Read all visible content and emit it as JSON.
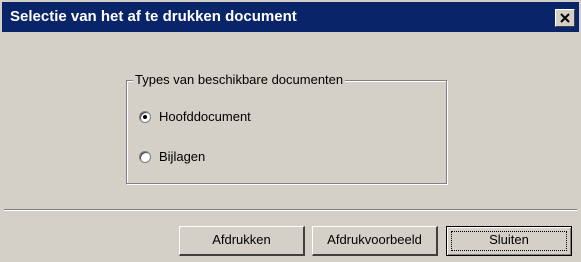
{
  "window": {
    "title": "Selectie van het af te drukken document",
    "title_bar_color": "#0a246a",
    "background_color": "#d4d0c8",
    "close_icon": "close-icon"
  },
  "document_types": {
    "legend": "Types van beschikbare documenten",
    "options": [
      {
        "label": "Hoofddocument",
        "selected": true
      },
      {
        "label": "Bijlagen",
        "selected": false
      }
    ]
  },
  "buttons": {
    "print_label": "Afdrukken",
    "preview_label": "Afdrukvoorbeeld",
    "close_label": "Sluiten"
  }
}
